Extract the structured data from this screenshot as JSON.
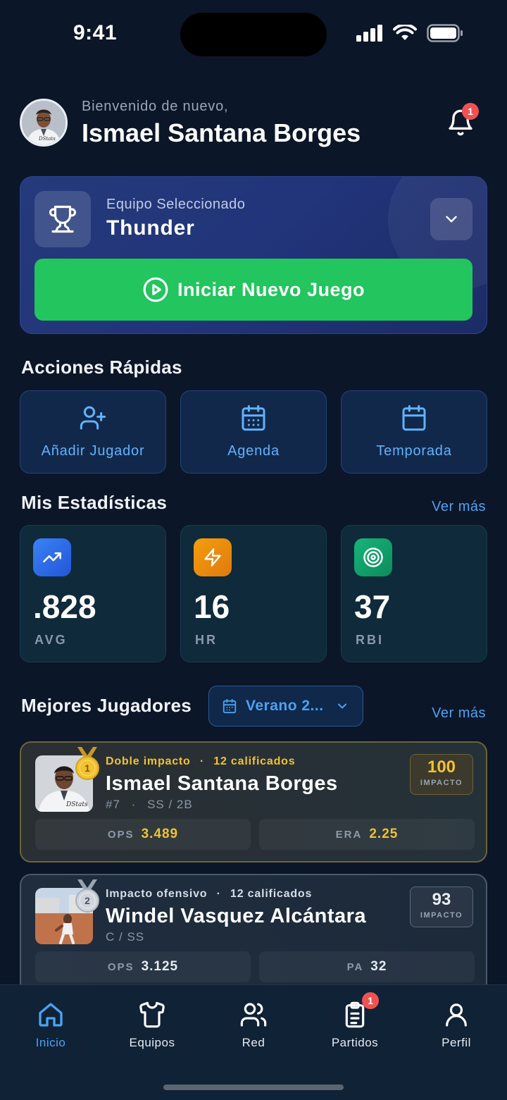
{
  "status_bar": {
    "time": "9:41"
  },
  "header": {
    "welcome": "Bienvenido de nuevo,",
    "user_name": "Ismael Santana Borges",
    "notification_count": "1"
  },
  "team": {
    "label": "Equipo Seleccionado",
    "name": "Thunder",
    "start_button": "Iniciar Nuevo Juego"
  },
  "quick_actions": {
    "title": "Acciones Rápidas",
    "items": [
      {
        "label": "Añadir Jugador",
        "icon": "add-user-icon"
      },
      {
        "label": "Agenda",
        "icon": "calendar-grid-icon"
      },
      {
        "label": "Temporada",
        "icon": "calendar-icon"
      }
    ]
  },
  "stats": {
    "title": "Mis Estadísticas",
    "see_more": "Ver más",
    "items": [
      {
        "value": ".828",
        "label": "AVG",
        "icon": "trending-up-icon",
        "color": "#2f6ef0"
      },
      {
        "value": "16",
        "label": "HR",
        "icon": "lightning-icon",
        "color": "#f08c12"
      },
      {
        "value": "37",
        "label": "RBI",
        "icon": "target-icon",
        "color": "#14a06a"
      }
    ]
  },
  "top_players": {
    "title": "Mejores Jugadores",
    "season": "Verano 2...",
    "see_more": "Ver más",
    "players": [
      {
        "rank": "1",
        "category": "Doble impacto",
        "qualified": "12 calificados",
        "name": "Ismael Santana Borges",
        "number": "#7",
        "position": "SS / 2B",
        "impact": "100",
        "impact_label": "IMPACTO",
        "stat1_key": "OPS",
        "stat1_val": "3.489",
        "stat2_key": "ERA",
        "stat2_val": "2.25"
      },
      {
        "rank": "2",
        "category": "Impacto ofensivo",
        "qualified": "12 calificados",
        "name": "Windel Vasquez Alcántara",
        "position": "C / SS",
        "impact": "93",
        "impact_label": "IMPACTO",
        "stat1_key": "OPS",
        "stat1_val": "3.125",
        "stat2_key": "PA",
        "stat2_val": "32"
      }
    ]
  },
  "nav": {
    "items": [
      {
        "label": "Inicio",
        "icon": "home-icon",
        "active": true
      },
      {
        "label": "Equipos",
        "icon": "shirt-icon"
      },
      {
        "label": "Red",
        "icon": "users-icon"
      },
      {
        "label": "Partidos",
        "icon": "clipboard-icon",
        "badge": "1"
      },
      {
        "label": "Perfil",
        "icon": "user-icon"
      }
    ]
  },
  "colors": {
    "background": "#0b1628",
    "accent": "#4aa3f5",
    "green": "#22c55e",
    "gold": "#f2c230",
    "badge": "#f05252"
  }
}
